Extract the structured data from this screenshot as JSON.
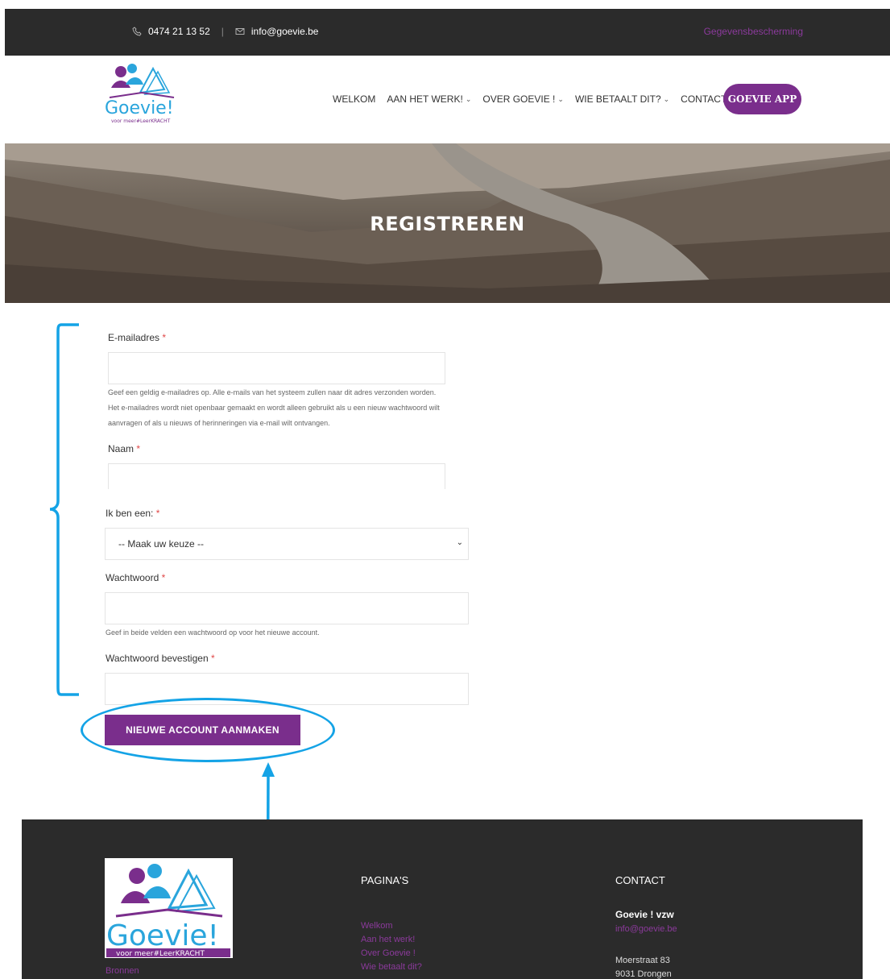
{
  "topbar": {
    "phone": "0474 21 13 52",
    "email": "info@goevie.be",
    "privacy_link": "Gegevensbescherming"
  },
  "header": {
    "logo_text": "Goevie!",
    "logo_tagline": "voor meer#LeerKRACHT",
    "nav": [
      {
        "label": "WELKOM",
        "has_dropdown": false
      },
      {
        "label": "AAN HET WERK!",
        "has_dropdown": true
      },
      {
        "label": "OVER GOEVIE !",
        "has_dropdown": true
      },
      {
        "label": "WIE BETAALT DIT?",
        "has_dropdown": true
      },
      {
        "label": "CONTACT",
        "has_dropdown": false
      }
    ],
    "app_button": "GOEVIE APP"
  },
  "hero": {
    "title": "REGISTREREN"
  },
  "form": {
    "email_label": "E-mailadres",
    "email_help": "Geef een geldig e-mailadres op. Alle e-mails van het systeem zullen naar dit adres verzonden worden. Het e-mailadres wordt niet openbaar gemaakt en wordt alleen gebruikt als u een nieuw wachtwoord wilt aanvragen of als u nieuws of herinneringen via e-mail wilt ontvangen.",
    "name_label": "Naam",
    "role_label": "Ik ben een:",
    "role_selected": "-- Maak uw keuze --",
    "password_label": "Wachtwoord",
    "password_help": "Geef in beide velden een wachtwoord op voor het nieuwe account.",
    "confirm_label": "Wachtwoord bevestigen",
    "required_mark": "*",
    "submit_label": "NIEUWE ACCOUNT AANMAKEN"
  },
  "footer": {
    "logo_text": "Goevie!",
    "logo_tagline": "voor meer#LeerKRACHT",
    "bronnen": "Bronnen",
    "pages_heading": "PAGINA'S",
    "pages": [
      "Welkom",
      "Aan het werk!",
      "Over Goevie !",
      "Wie betaalt dit?"
    ],
    "contact_heading": "CONTACT",
    "org_name": "Goevie ! vzw",
    "org_email": "info@goevie.be",
    "address_line1": "Moerstraat 83",
    "address_line2": "9031 Drongen"
  },
  "colors": {
    "brand_purple": "#7a2e8c",
    "dark_bar": "#2b2b2b",
    "annotation_blue": "#14a3e6",
    "required_red": "#e04848"
  }
}
